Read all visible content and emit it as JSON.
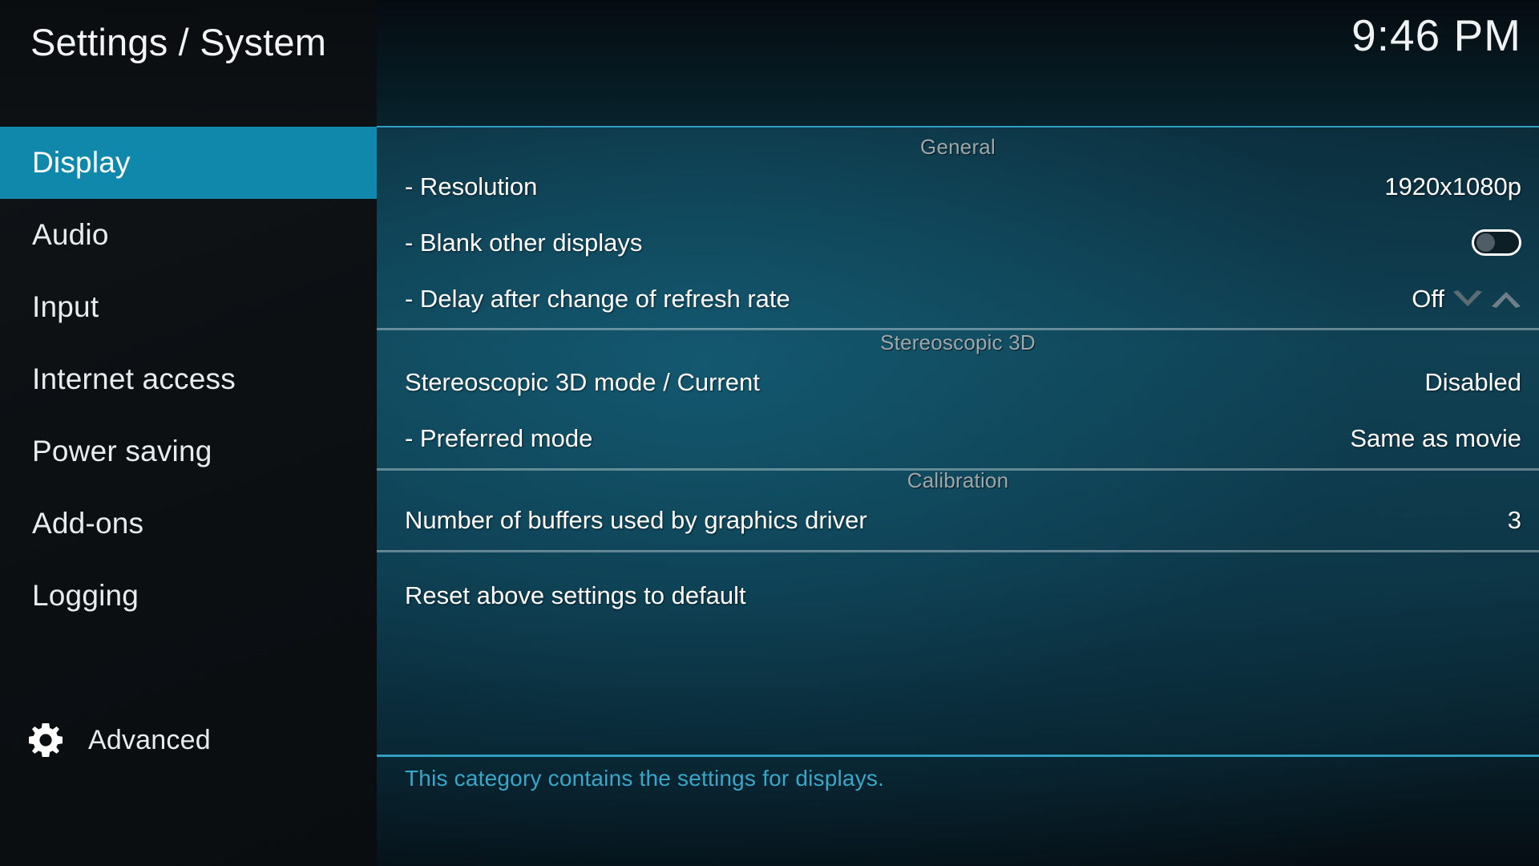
{
  "header": {
    "title": "Settings / System",
    "clock": "9:46 PM"
  },
  "sidebar": {
    "items": [
      {
        "label": "Display",
        "selected": true
      },
      {
        "label": "Audio",
        "selected": false
      },
      {
        "label": "Input",
        "selected": false
      },
      {
        "label": "Internet access",
        "selected": false
      },
      {
        "label": "Power saving",
        "selected": false
      },
      {
        "label": "Add-ons",
        "selected": false
      },
      {
        "label": "Logging",
        "selected": false
      }
    ],
    "advanced": {
      "label": "Advanced",
      "icon": "gear-icon"
    }
  },
  "content": {
    "sections": [
      {
        "title": "General",
        "rows": [
          {
            "label": "- Resolution",
            "value": "1920x1080p",
            "control": "value"
          },
          {
            "label": "- Blank other displays",
            "value": "",
            "control": "toggle",
            "toggle_state": "off"
          },
          {
            "label": "- Delay after change of refresh rate",
            "value": "Off",
            "control": "spinner"
          }
        ]
      },
      {
        "title": "Stereoscopic 3D",
        "rows": [
          {
            "label": "Stereoscopic 3D mode / Current",
            "value": "Disabled",
            "control": "value"
          },
          {
            "label": "- Preferred mode",
            "value": "Same as movie",
            "control": "value"
          }
        ]
      },
      {
        "title": "Calibration",
        "rows": [
          {
            "label": "Number of buffers used by graphics driver",
            "value": "3",
            "control": "value"
          }
        ]
      },
      {
        "title": "",
        "rows": [
          {
            "label": "Reset above settings to default",
            "value": "",
            "control": "none"
          }
        ]
      }
    ]
  },
  "footer": {
    "description": "This category contains the settings for displays."
  },
  "colors": {
    "accent": "#1088ac",
    "rule": "#2f9ec0",
    "footer_text": "#3aa6c8",
    "section_title": "#9ea8ab",
    "sidebar_bg": "#0c1013"
  }
}
